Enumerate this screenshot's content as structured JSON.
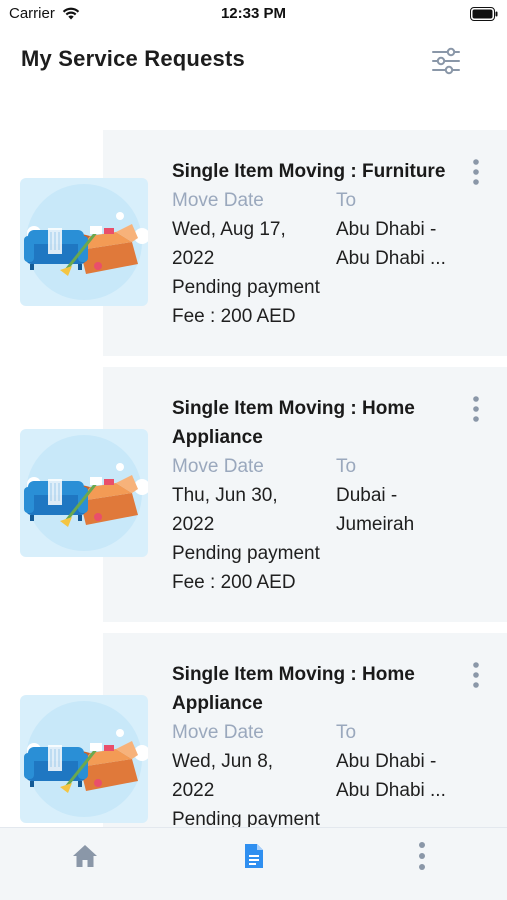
{
  "status_bar": {
    "carrier": "Carrier",
    "time": "12:33 PM"
  },
  "header": {
    "title": "My Service Requests",
    "filter_icon": "sliders-icon"
  },
  "requests": [
    {
      "title": "Single Item Moving : Furniture",
      "move_date_label": "Move Date",
      "to_label": "To",
      "date_line1": "Wed, Aug 17,",
      "date_line2": "2022",
      "to_line1": "Abu Dhabi -",
      "to_line2": "Abu Dhabi ...",
      "status": "Pending payment",
      "fee": "Fee : 200 AED"
    },
    {
      "title_line1": "Single Item Moving : Home",
      "title_line2": "Appliance",
      "move_date_label": "Move Date",
      "to_label": "To",
      "date_line1": "Thu, Jun 30,",
      "date_line2": "2022",
      "to_line1": "Dubai -",
      "to_line2": "Jumeirah",
      "status": "Pending payment",
      "fee": "Fee : 200 AED"
    },
    {
      "title_line1": "Single Item Moving : Home",
      "title_line2": "Appliance",
      "move_date_label": "Move Date",
      "to_label": "To",
      "date_line1": "Wed, Jun 8,",
      "date_line2": "2022",
      "to_line1": "Abu Dhabi -",
      "to_line2": "Abu Dhabi ...",
      "status": "Pending payment"
    }
  ],
  "bottom_nav": {
    "items": [
      {
        "icon": "home-icon"
      },
      {
        "icon": "document-icon",
        "active": true
      },
      {
        "icon": "more-vertical-icon"
      }
    ]
  },
  "colors": {
    "card_bg": "#f3f6f8",
    "label": "#9aa8bd",
    "accent": "#2f8ff0",
    "icon_gray": "#8a97a8"
  }
}
